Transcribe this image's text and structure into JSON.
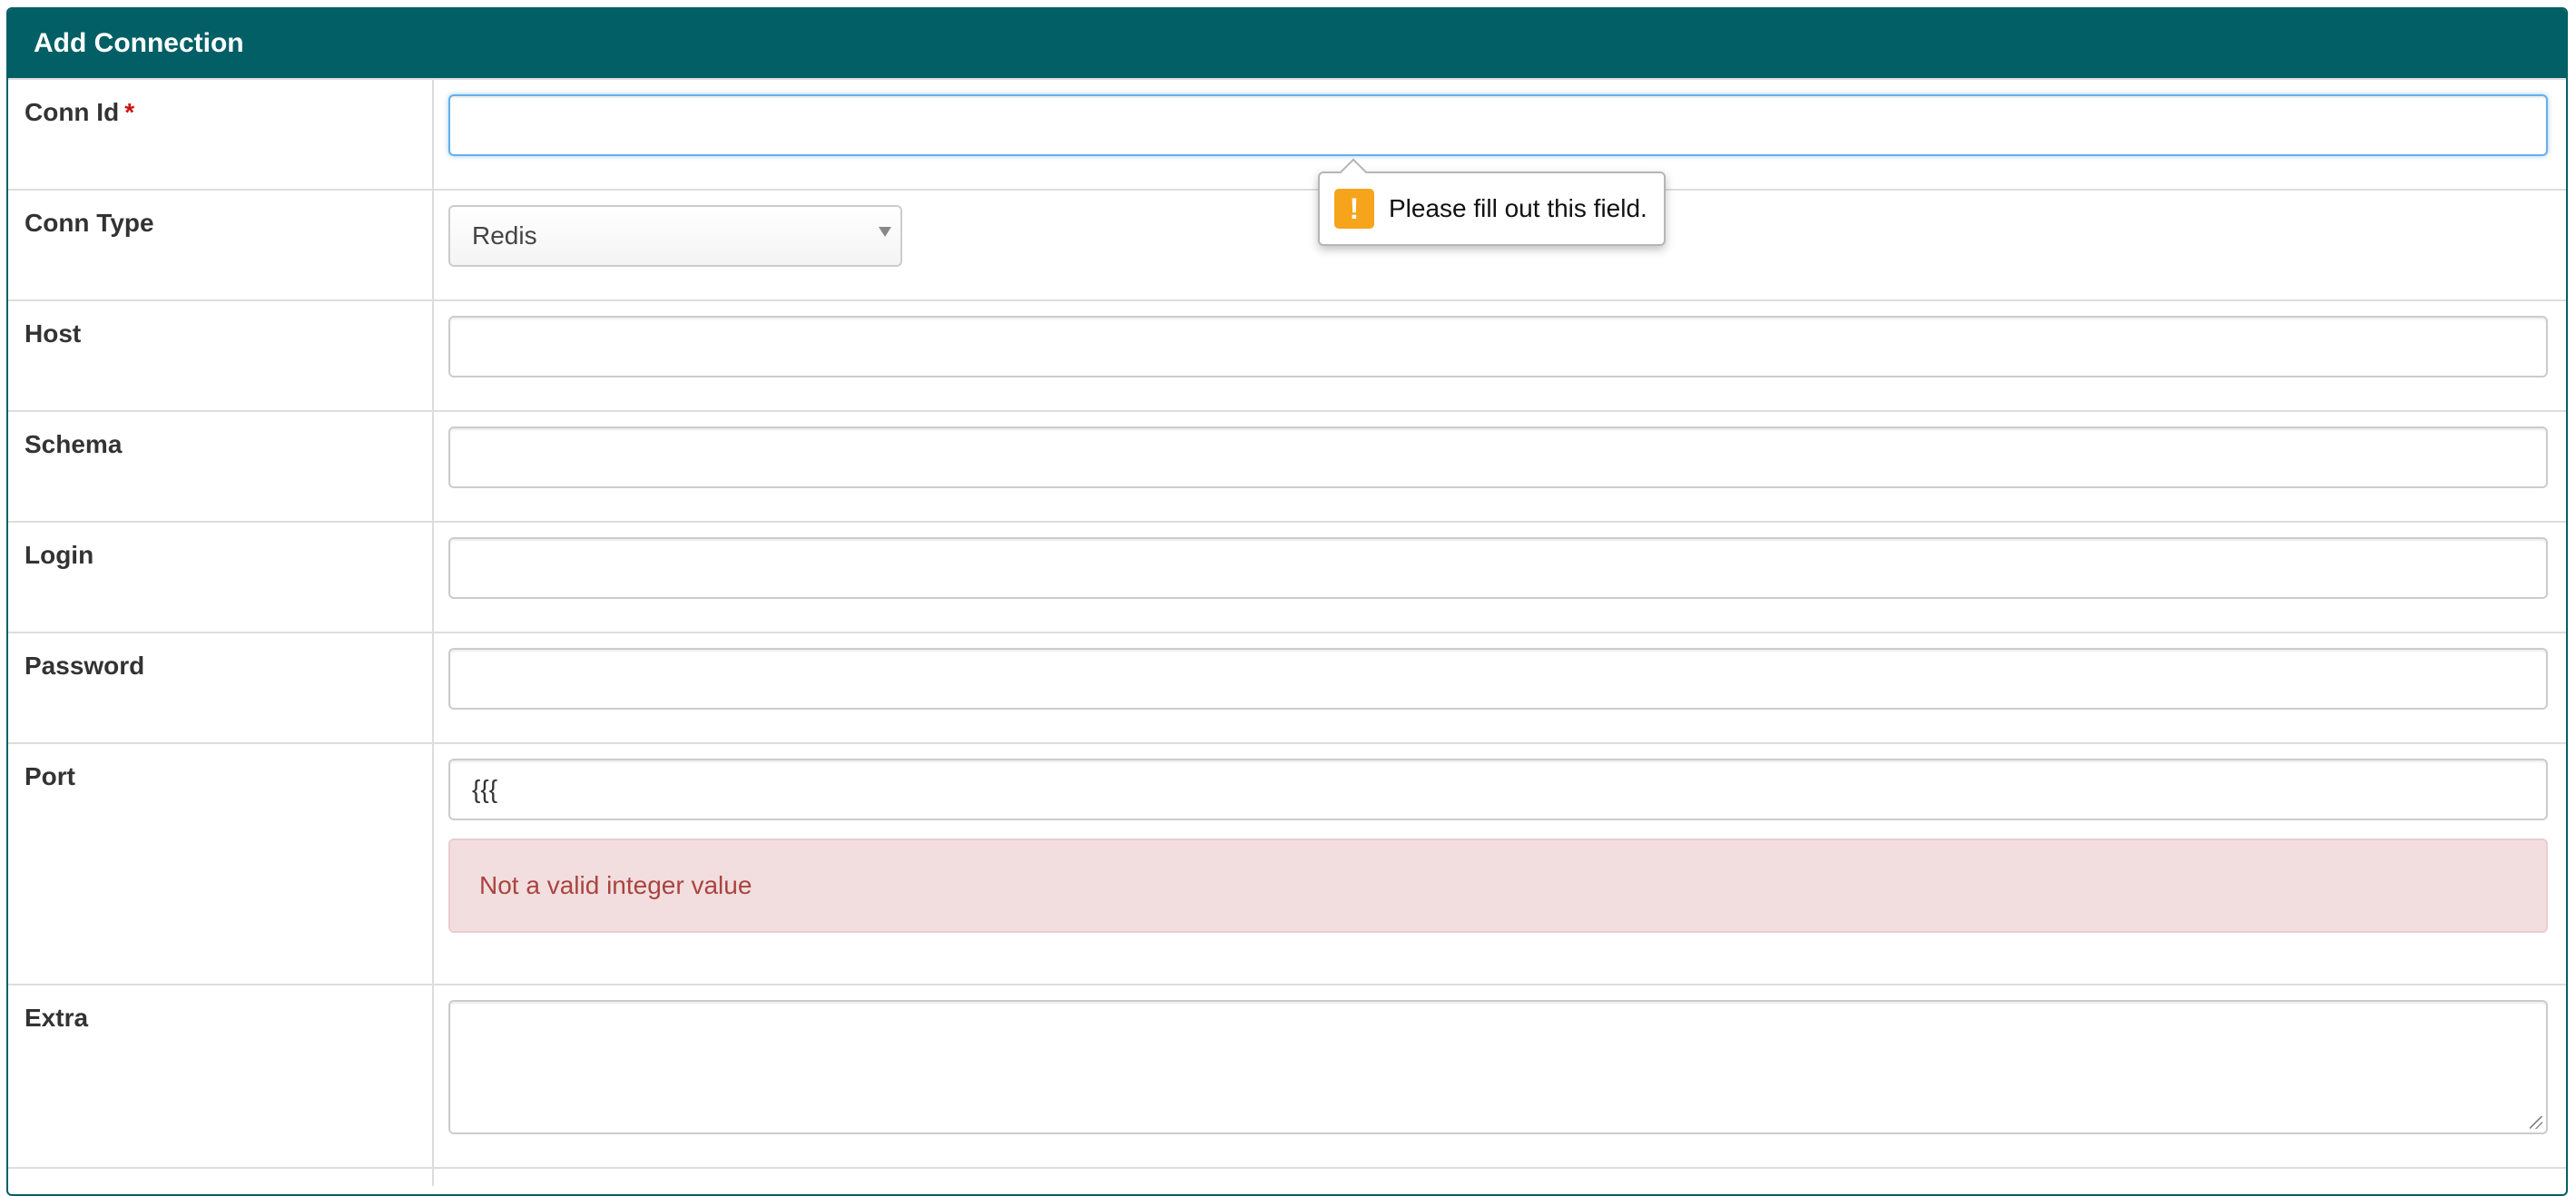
{
  "panel": {
    "title": "Add Connection"
  },
  "fields": {
    "conn_id": {
      "label": "Conn Id",
      "required_marker": "*",
      "value": ""
    },
    "conn_type": {
      "label": "Conn Type",
      "selected": "Redis"
    },
    "host": {
      "label": "Host",
      "value": ""
    },
    "schema": {
      "label": "Schema",
      "value": ""
    },
    "login": {
      "label": "Login",
      "value": ""
    },
    "password": {
      "label": "Password",
      "value": ""
    },
    "port": {
      "label": "Port",
      "value": "{{{",
      "error": "Not a valid integer value"
    },
    "extra": {
      "label": "Extra",
      "value": ""
    }
  },
  "validation_tooltip": {
    "icon": "warning-icon",
    "icon_glyph": "!",
    "message": "Please fill out this field."
  },
  "colors": {
    "header": "#035f66",
    "required": "#cc1111",
    "error_bg": "#f2dede",
    "error_text": "#a94442",
    "warning": "#f5a41c"
  }
}
